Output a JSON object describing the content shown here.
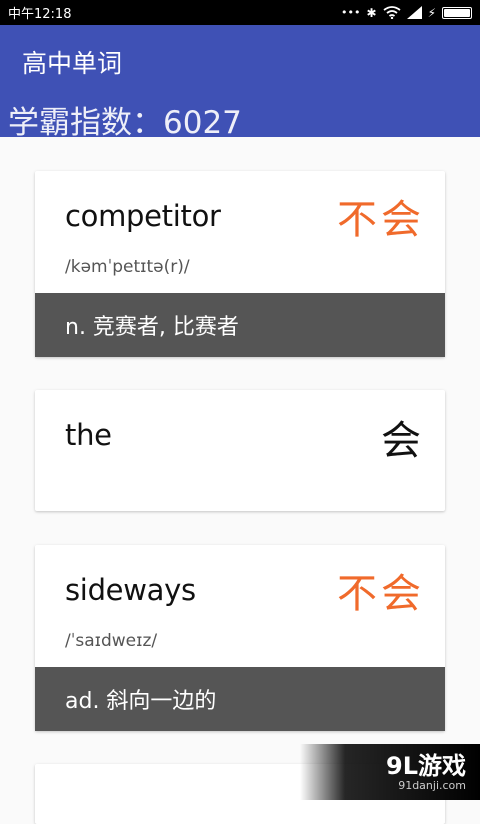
{
  "status_bar": {
    "time": "中午12:18",
    "icons": [
      "more-dots-icon",
      "bluetooth-icon",
      "wifi-icon",
      "signal-icon",
      "charging-icon",
      "battery-icon"
    ],
    "dots": "•••",
    "bluetooth": "✱",
    "charging": "⚡"
  },
  "app": {
    "title": "高中单词",
    "score_text": "学霸指数：6027",
    "header_color": "#3f51b5"
  },
  "cards": [
    {
      "word": "competitor",
      "phonetic": "/kəmˈpetɪtə(r)/",
      "badge": "不会",
      "meaning": "n. 竞赛者, 比赛者"
    },
    {
      "word": "the",
      "phonetic": "",
      "badge": "会",
      "meaning": ""
    },
    {
      "word": "sideways",
      "phonetic": "/ˈsaɪdweɪz/",
      "badge": "不会",
      "meaning": "ad. 斜向一边的"
    }
  ],
  "badge_colors": {
    "unknown": "#f06a2b",
    "known": "#111111"
  },
  "battery_level": 1.0,
  "watermark": {
    "main": "9L游戏",
    "sub": "91danji.com"
  }
}
